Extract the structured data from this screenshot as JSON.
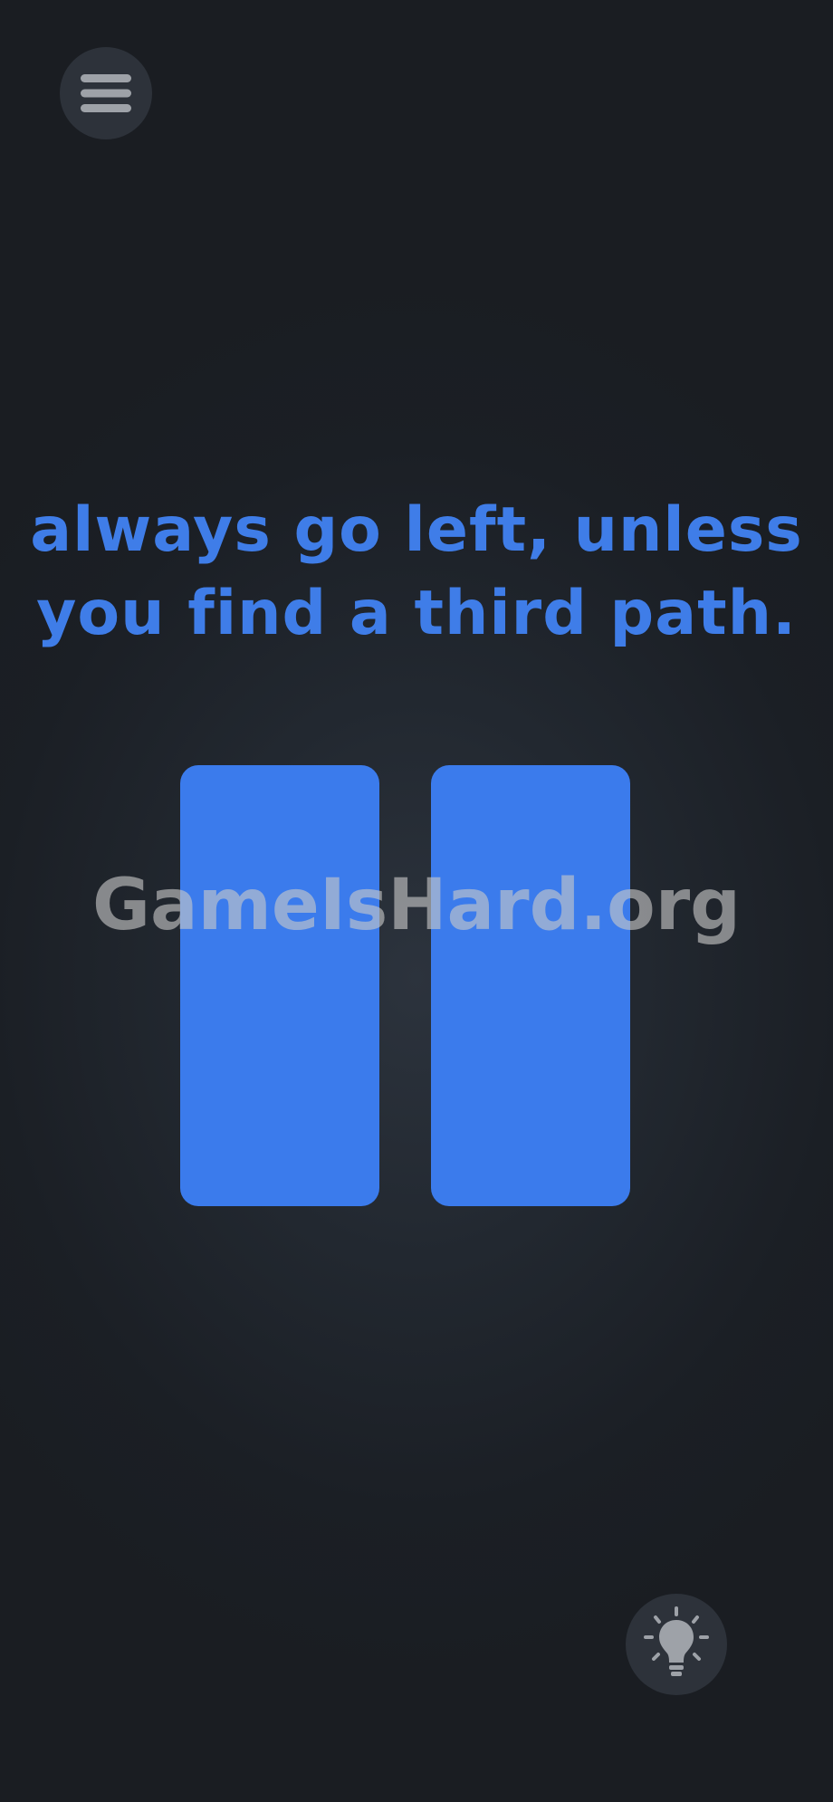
{
  "menu": {
    "icon": "hamburger-menu-icon"
  },
  "puzzle": {
    "prompt_line1": "always go left, unless",
    "prompt_line2": "you find a third path.",
    "panels": [
      {
        "name": "left-panel"
      },
      {
        "name": "right-panel"
      }
    ],
    "panel_color": "#3b7bec",
    "text_color": "#3f7de8"
  },
  "watermark": {
    "text": "GameIsHard.org"
  },
  "hint": {
    "icon": "lightbulb-icon"
  }
}
